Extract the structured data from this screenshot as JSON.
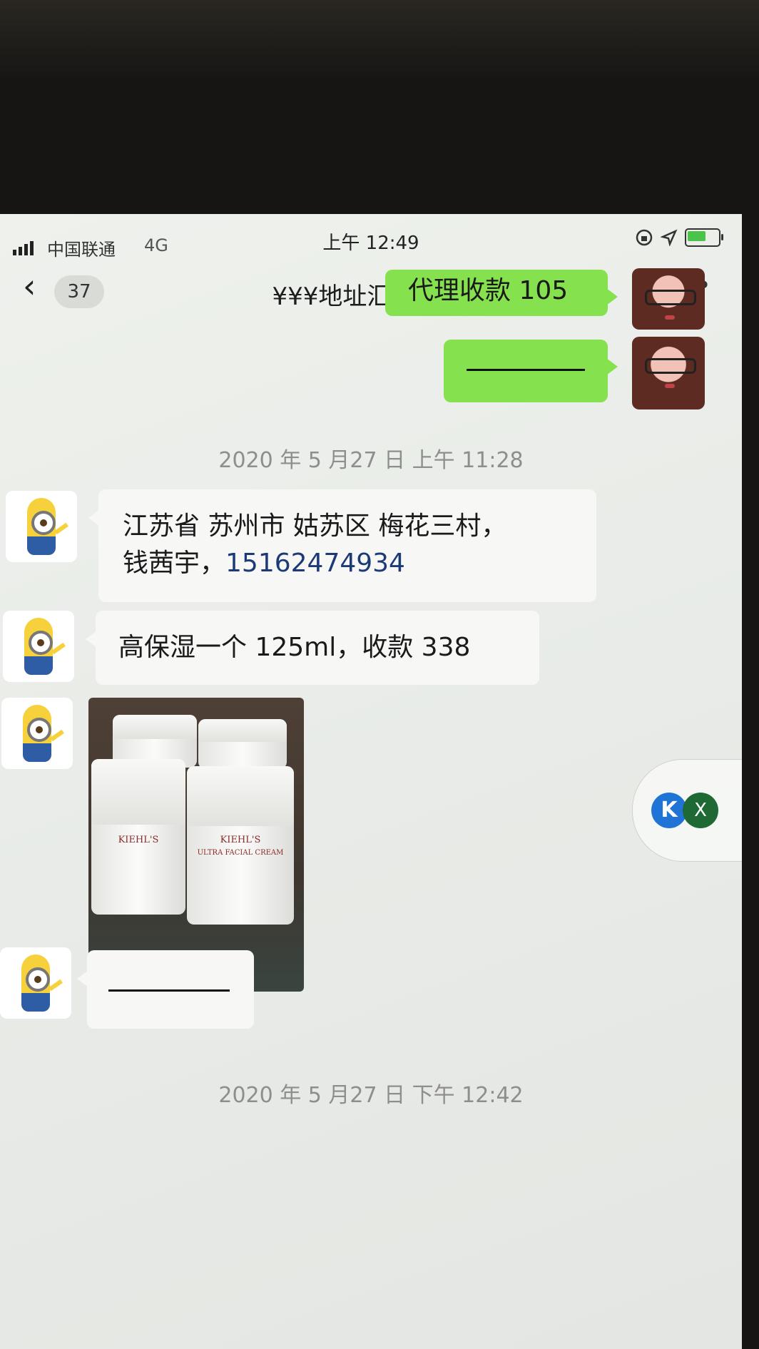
{
  "status_bar": {
    "carrier": "中国联通",
    "network": "4G",
    "time": "上午 12:49",
    "battery_level": 0.6,
    "icons": [
      "signal-icon",
      "rotation-lock-icon",
      "location-icon",
      "battery-charging-icon"
    ]
  },
  "nav": {
    "unread_count": "37",
    "title": "¥¥¥地址汇(11)",
    "icons": [
      "back-chevron-icon",
      "mute-bell-icon",
      "more-icon"
    ]
  },
  "messages": {
    "m1": {
      "sender": "self",
      "text": "代理收款 105"
    },
    "m2": {
      "sender": "self",
      "text": ""
    },
    "ts1": "2020 年 5 月27 日 上午 11:28",
    "m3": {
      "sender": "member",
      "line1": "江苏省 苏州市 姑苏区 梅花三村，",
      "line2_prefix": "钱茜宇，",
      "phone": "15162474934"
    },
    "m4": {
      "sender": "member",
      "text": "高保湿一个 125ml，收款 338"
    },
    "m5": {
      "sender": "member",
      "type": "image",
      "jar_brand": "KIEHL'S",
      "jar_product": "ULTRA FACIAL CREAM"
    },
    "m6": {
      "sender": "member",
      "text": ""
    },
    "ts2": "2020 年 5 月27 日 下午 12:42"
  },
  "floating_widget": {
    "x_label": "X",
    "k_label": "K"
  },
  "colors": {
    "self_bubble": "#85e24e",
    "other_bubble": "#f7f8f6",
    "background": "#eef1ec"
  }
}
